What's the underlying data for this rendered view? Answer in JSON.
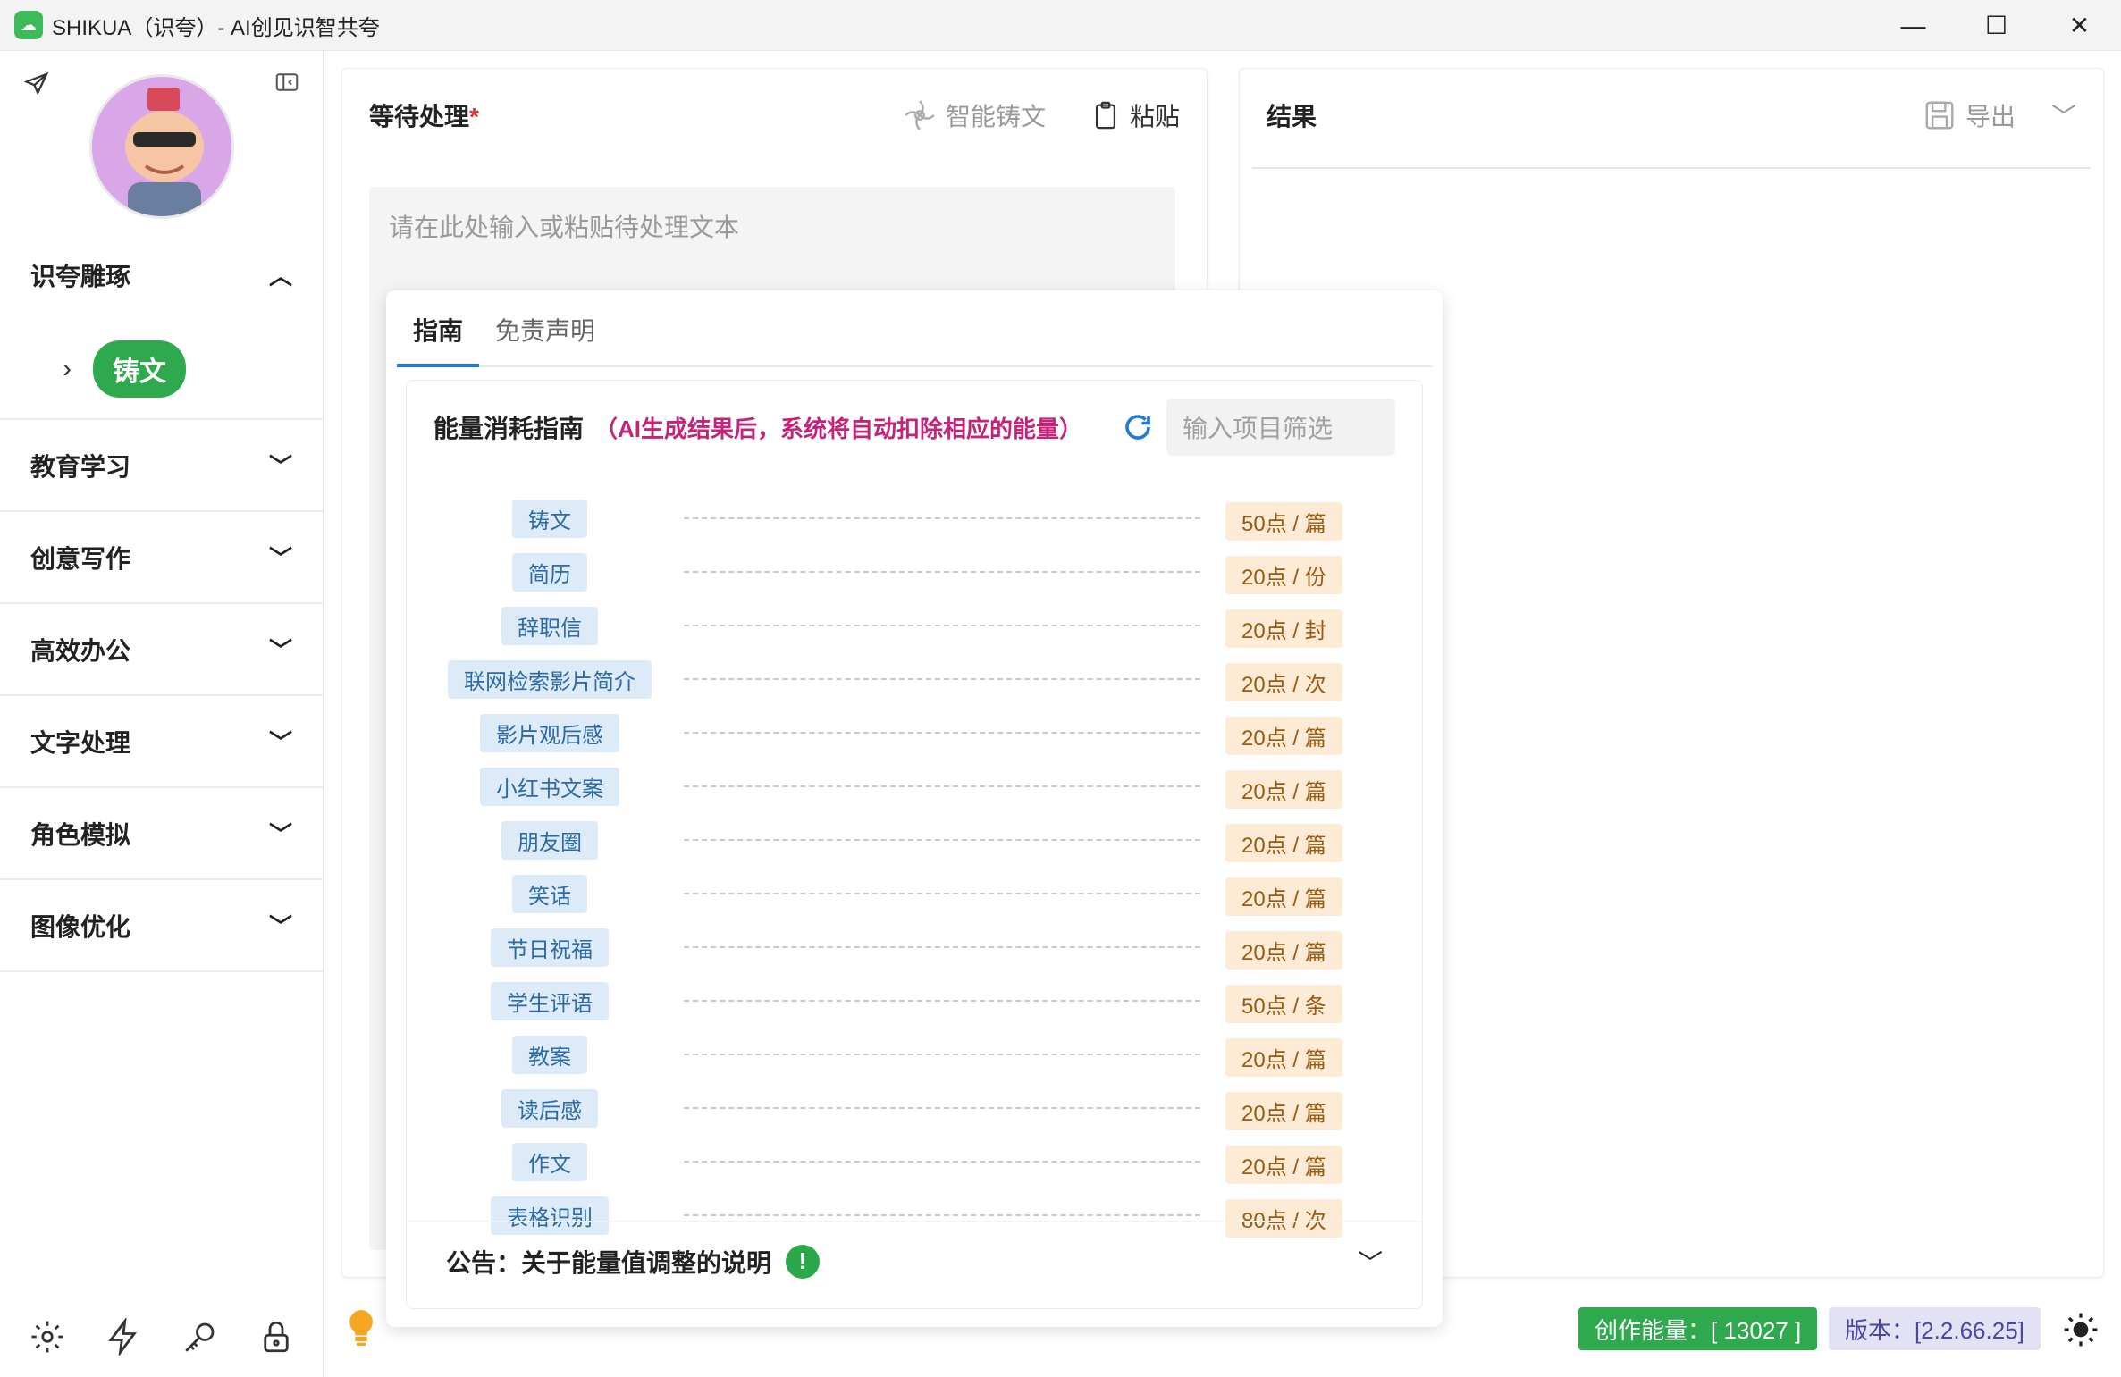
{
  "window": {
    "title": "SHIKUA（识夸）- AI创见识智共夸",
    "minimize_glyph": "—",
    "maximize_glyph": "☐",
    "close_glyph": "✕"
  },
  "sidebar": {
    "groups": [
      {
        "label": "识夸雕琢",
        "expanded": true,
        "items": [
          {
            "label": "铸文"
          }
        ]
      },
      {
        "label": "教育学习",
        "expanded": false
      },
      {
        "label": "创意写作",
        "expanded": false
      },
      {
        "label": "高效办公",
        "expanded": false
      },
      {
        "label": "文字处理",
        "expanded": false
      },
      {
        "label": "角色模拟",
        "expanded": false
      },
      {
        "label": "图像优化",
        "expanded": false
      }
    ],
    "footer_icons": [
      "settings-icon",
      "lightning-icon",
      "key-icon",
      "lock-icon"
    ]
  },
  "input_panel": {
    "title": "等待处理",
    "required_mark": "*",
    "smart_button": "智能铸文",
    "paste_button": "粘贴",
    "placeholder": "请在此处输入或粘贴待处理文本"
  },
  "result_panel": {
    "title": "结果",
    "export_button": "导出"
  },
  "popover": {
    "tabs": [
      "指南",
      "免责声明"
    ],
    "active_tab": 0,
    "guide": {
      "title": "能量消耗指南",
      "note": "（AI生成结果后，系统将自动扣除相应的能量）",
      "filter_placeholder": "输入项目筛选",
      "rows": [
        {
          "name": "铸文",
          "cost": "50点 / 篇"
        },
        {
          "name": "简历",
          "cost": "20点 / 份"
        },
        {
          "name": "辞职信",
          "cost": "20点 / 封"
        },
        {
          "name": "联网检索影片简介",
          "cost": "20点 / 次"
        },
        {
          "name": "影片观后感",
          "cost": "20点 / 篇"
        },
        {
          "name": "小红书文案",
          "cost": "20点 / 篇"
        },
        {
          "name": "朋友圈",
          "cost": "20点 / 篇"
        },
        {
          "name": "笑话",
          "cost": "20点 / 篇"
        },
        {
          "name": "节日祝福",
          "cost": "20点 / 篇"
        },
        {
          "name": "学生评语",
          "cost": "50点 / 条"
        },
        {
          "name": "教案",
          "cost": "20点 / 篇"
        },
        {
          "name": "读后感",
          "cost": "20点 / 篇"
        },
        {
          "name": "作文",
          "cost": "20点 / 篇"
        },
        {
          "name": "表格识别",
          "cost": "80点 / 次"
        }
      ]
    },
    "notice": "公告：关于能量值调整的说明",
    "notice_badge": "!"
  },
  "status_bar": {
    "energy_label": "创作能量：[ 13027 ]",
    "version_label": "版本：[2.2.66.25]"
  },
  "colors": {
    "accent_green": "#2fa94d",
    "note_magenta": "#c4237a",
    "tag_blue_bg": "#dcebf7",
    "cost_orange_bg": "#fdebd6"
  }
}
